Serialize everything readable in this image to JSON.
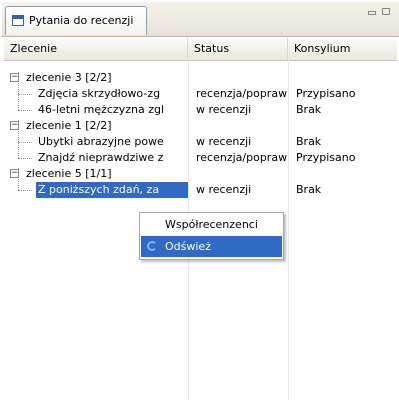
{
  "tab": {
    "title": "Pytania do recenzji"
  },
  "columns": [
    "Zlecenie",
    "Status",
    "Konsylium"
  ],
  "groups": [
    {
      "label": "zlecenie 3 [2/2]",
      "children": [
        {
          "name": "Zdjęcia skrzydłowo-zg",
          "status": "recenzja/poprawk",
          "konsylium": "Przypisano"
        },
        {
          "name": "46-letni mężczyzna zgl",
          "status": "w recenzji",
          "konsylium": "Brak"
        }
      ]
    },
    {
      "label": "zlecenie 1 [2/2]",
      "children": [
        {
          "name": "Ubytki abrazyjne powe",
          "status": "w recenzji",
          "konsylium": "Brak"
        },
        {
          "name": "Znajdź nieprawdziwe z",
          "status": "recenzja/poprawk",
          "konsylium": "Przypisano"
        }
      ]
    },
    {
      "label": "zlecenie 5 [1/1]",
      "children": [
        {
          "name": "Z poniższych zdań, za",
          "status": "w recenzji",
          "konsylium": "Brak"
        }
      ]
    }
  ],
  "context_menu": {
    "items": [
      "Współrecenzenci",
      "Odśwież"
    ],
    "active_index": 1
  },
  "colors": {
    "selection": "#316ac5",
    "tab_border": "#8e9bb3"
  }
}
